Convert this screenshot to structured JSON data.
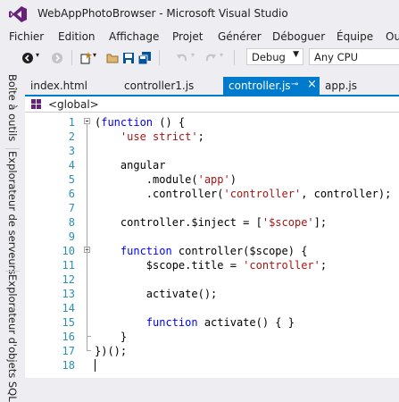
{
  "window": {
    "title": "WebAppPhotoBrowser - Microsoft Visual Studio"
  },
  "menu": [
    "Fichier",
    "Edition",
    "Affichage",
    "Projet",
    "Générer",
    "Déboguer",
    "Équipe",
    "Ou"
  ],
  "toolbar": {
    "configuration": "Debug",
    "platform": "Any CPU"
  },
  "sidebar": [
    "Boîte à outils",
    "Explorateur de serveurs",
    "Explorateur d'objets SQL"
  ],
  "tabs": [
    {
      "label": "index.html",
      "active": false
    },
    {
      "label": "controller1.js",
      "active": false
    },
    {
      "label": "controller.js",
      "active": true
    },
    {
      "label": "app.js",
      "active": false
    }
  ],
  "editor": {
    "scope": "<global>",
    "lines": [
      {
        "n": "1",
        "tokens": [
          [
            "p",
            "(",
            ""
          ],
          [
            "k",
            "function",
            ""
          ],
          [
            "p",
            " () {",
            ""
          ]
        ]
      },
      {
        "n": "2",
        "tokens": [
          [
            "p",
            "    ",
            ""
          ],
          [
            "s",
            "'use strict'",
            ""
          ],
          [
            "p",
            ";",
            ""
          ]
        ]
      },
      {
        "n": "3",
        "tokens": []
      },
      {
        "n": "4",
        "tokens": [
          [
            "p",
            "    angular",
            ""
          ]
        ]
      },
      {
        "n": "5",
        "tokens": [
          [
            "p",
            "        .module(",
            ""
          ],
          [
            "s",
            "'app'",
            ""
          ],
          [
            "p",
            ")",
            ""
          ]
        ]
      },
      {
        "n": "6",
        "tokens": [
          [
            "p",
            "        .controller(",
            ""
          ],
          [
            "s",
            "'controller'",
            ""
          ],
          [
            "p",
            ", controller);",
            ""
          ]
        ]
      },
      {
        "n": "7",
        "tokens": []
      },
      {
        "n": "8",
        "tokens": [
          [
            "p",
            "    controller.$inject = [",
            ""
          ],
          [
            "s",
            "'$scope'",
            ""
          ],
          [
            "p",
            "];",
            ""
          ]
        ]
      },
      {
        "n": "9",
        "tokens": []
      },
      {
        "n": "10",
        "tokens": [
          [
            "p",
            "    ",
            ""
          ],
          [
            "k",
            "function",
            ""
          ],
          [
            "p",
            " controller($scope) {",
            ""
          ]
        ]
      },
      {
        "n": "11",
        "tokens": [
          [
            "p",
            "        $scope.title = ",
            ""
          ],
          [
            "s",
            "'controller'",
            ""
          ],
          [
            "p",
            ";",
            ""
          ]
        ]
      },
      {
        "n": "12",
        "tokens": []
      },
      {
        "n": "13",
        "tokens": [
          [
            "p",
            "        activate();",
            ""
          ]
        ]
      },
      {
        "n": "14",
        "tokens": []
      },
      {
        "n": "15",
        "tokens": [
          [
            "p",
            "        ",
            ""
          ],
          [
            "k",
            "function",
            ""
          ],
          [
            "p",
            " activate() { }",
            ""
          ]
        ]
      },
      {
        "n": "16",
        "tokens": [
          [
            "p",
            "    }",
            ""
          ]
        ]
      },
      {
        "n": "17",
        "tokens": [
          [
            "p",
            "})();",
            ""
          ]
        ]
      },
      {
        "n": "18",
        "tokens": []
      }
    ]
  }
}
